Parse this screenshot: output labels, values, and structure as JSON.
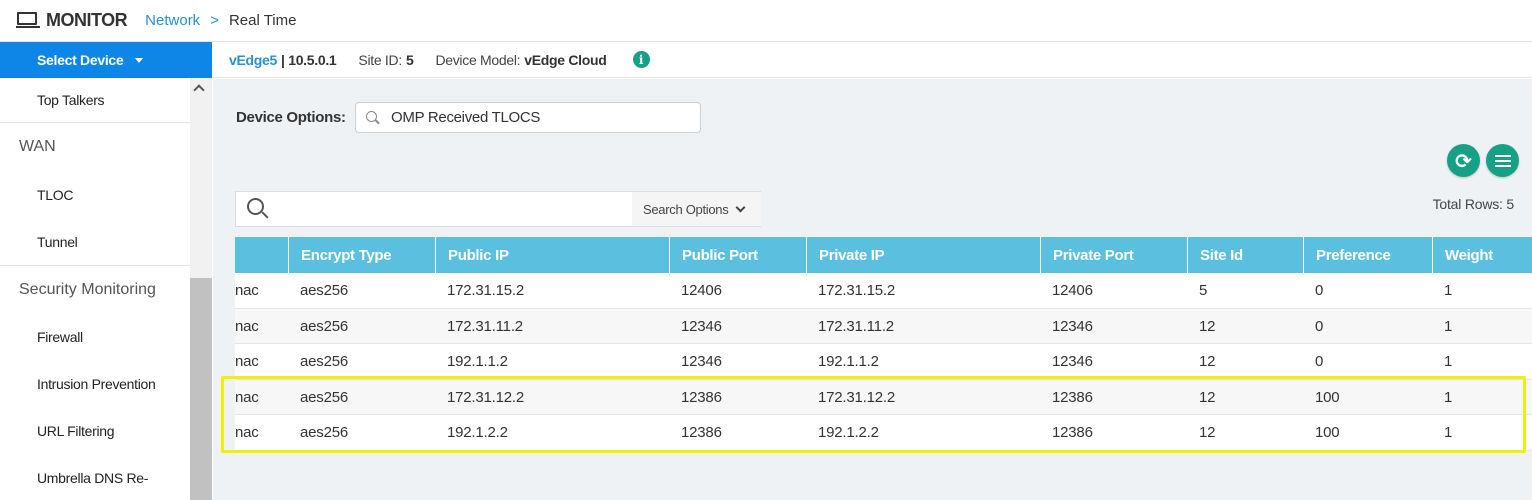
{
  "header": {
    "title": "MONITOR",
    "breadcrumb_link": "Network",
    "breadcrumb_sep": ">",
    "breadcrumb_current": "Real Time"
  },
  "sidebar": {
    "select_device": "Select Device",
    "items": [
      {
        "type": "item",
        "label": "Top Talkers"
      },
      {
        "type": "section",
        "label": "WAN"
      },
      {
        "type": "item",
        "label": "TLOC"
      },
      {
        "type": "item",
        "label": "Tunnel"
      },
      {
        "type": "section",
        "label": "Security Monitoring"
      },
      {
        "type": "item",
        "label": "Firewall"
      },
      {
        "type": "item",
        "label": "Intrusion Prevention"
      },
      {
        "type": "item",
        "label": "URL Filtering"
      },
      {
        "type": "item",
        "label": "Umbrella DNS Re-"
      }
    ]
  },
  "device": {
    "name": "vEdge5",
    "ip": "| 10.5.0.1",
    "site_label": "Site ID:",
    "site_value": "5",
    "model_label": "Device Model:",
    "model_value": "vEdge Cloud",
    "info_icon": "info-icon"
  },
  "device_options": {
    "label": "Device Options:",
    "value": "OMP Received TLOCS"
  },
  "search": {
    "placeholder": "",
    "options_label": "Search Options"
  },
  "total_rows": "Total Rows: 5",
  "colors": {
    "accent": "#0e86e8",
    "table_header": "#5bc0e0",
    "action_button": "#16a085",
    "highlight": "#f0f000"
  },
  "table": {
    "columns": [
      "",
      "Encrypt Type",
      "Public IP",
      "Public Port",
      "Private IP",
      "Private Port",
      "Site Id",
      "Preference",
      "Weight"
    ],
    "rows": [
      [
        "nac",
        "aes256",
        "172.31.15.2",
        "12406",
        "172.31.15.2",
        "12406",
        "5",
        "0",
        "1"
      ],
      [
        "nac",
        "aes256",
        "172.31.11.2",
        "12346",
        "172.31.11.2",
        "12346",
        "12",
        "0",
        "1"
      ],
      [
        "nac",
        "aes256",
        "192.1.1.2",
        "12346",
        "192.1.1.2",
        "12346",
        "12",
        "0",
        "1"
      ],
      [
        "nac",
        "aes256",
        "172.31.12.2",
        "12386",
        "172.31.12.2",
        "12386",
        "12",
        "100",
        "1"
      ],
      [
        "nac",
        "aes256",
        "192.1.2.2",
        "12386",
        "192.1.2.2",
        "12386",
        "12",
        "100",
        "1"
      ]
    ]
  }
}
